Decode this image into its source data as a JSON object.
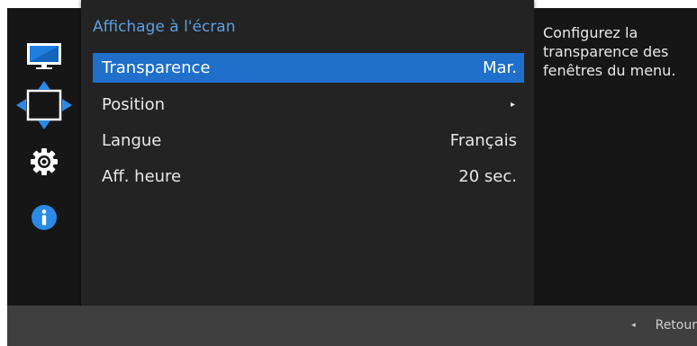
{
  "menu": {
    "title": "Affichage à l'écran",
    "items": [
      {
        "label": "Transparence",
        "value": "Mar.",
        "selected": true
      },
      {
        "label": "Position",
        "value": "▸",
        "selected": false
      },
      {
        "label": "Langue",
        "value": "Français",
        "selected": false
      },
      {
        "label": "Aff. heure",
        "value": "20 sec.",
        "selected": false
      }
    ]
  },
  "sidebar": {
    "icons": [
      "monitor-icon",
      "move-arrows-icon",
      "gear-icon",
      "info-icon"
    ]
  },
  "description": "Configurez la transparence des fenêtres du menu.",
  "footer": {
    "back_icon": "◂",
    "back_label": "Retour"
  },
  "colors": {
    "accent": "#1f6fcb",
    "title": "#5d9fe0",
    "panel": "#232323",
    "rail": "#161616",
    "footer": "#3f3f3f"
  }
}
